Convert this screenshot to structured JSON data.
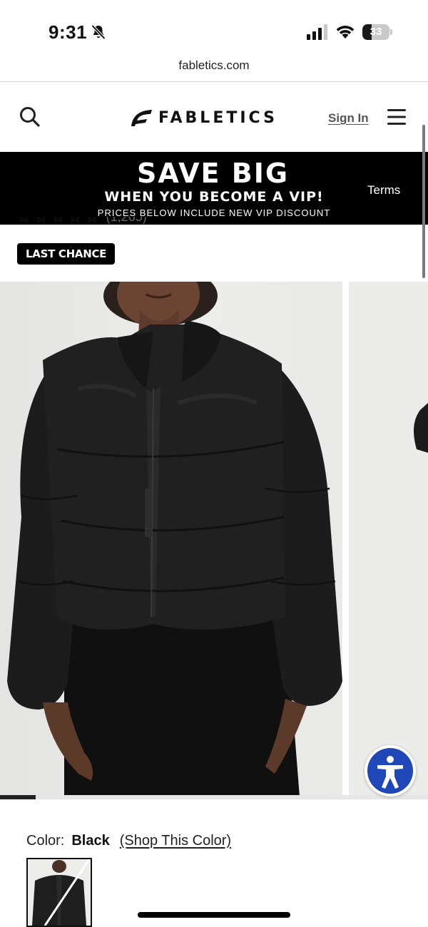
{
  "status_bar": {
    "time": "9:31",
    "battery_level": "33",
    "bell_icon": "bell-slash-icon",
    "signal_icon": "cellular-signal-icon",
    "wifi_icon": "wifi-icon"
  },
  "browser": {
    "url": "fabletics.com"
  },
  "header": {
    "brand": "FABLETICS",
    "sign_in": "Sign In",
    "search_icon": "search-icon",
    "menu_icon": "hamburger-menu-icon"
  },
  "promo": {
    "title": "SAVE BIG",
    "subtitle": "WHEN YOU BECOME A VIP!",
    "note": "PRICES BELOW INCLUDE NEW VIP DISCOUNT",
    "terms": "Terms"
  },
  "product": {
    "rating_count": "(1,265)",
    "badge": "LAST CHANCE",
    "gallery_progress": 0.083
  },
  "color": {
    "label": "Color:",
    "value": "Black",
    "link": "(Shop This Color)"
  },
  "colors": {
    "accent_blue": "#1f47b7",
    "banner_black": "#000000"
  }
}
